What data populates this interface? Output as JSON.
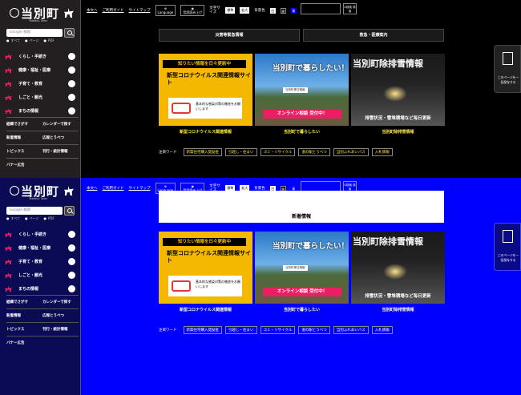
{
  "logo": {
    "title": "当別町",
    "subtitle": "Tobetsu Town"
  },
  "search": {
    "placeholder": "Google 検索",
    "options": [
      "すべて",
      "ページ",
      "PDF"
    ]
  },
  "menu": [
    {
      "label": "くらし・手続き"
    },
    {
      "label": "健康・福祉・医療"
    },
    {
      "label": "子育て・教育"
    },
    {
      "label": "しごと・観光"
    },
    {
      "label": "まちの情報"
    }
  ],
  "links": [
    [
      "組織でさがす",
      "カレンダーで探す"
    ],
    [
      "新着情報",
      "広報とうべつ"
    ],
    [
      "トピックス",
      "刊行・統計情報"
    ],
    [
      "バナー広告",
      ""
    ]
  ],
  "topbar": {
    "home": "本文へ",
    "guide": "ご利用ガイド",
    "sitemap": "サイトマップ",
    "language": "Language",
    "speech": "音読読み上げ",
    "textsize": "文字サイズ",
    "normal": "標準",
    "large": "拡大",
    "contrast": "背景色",
    "c1": "白",
    "c2": "黒",
    "c3": "青",
    "search_btn": "G検索 検索"
  },
  "nav": {
    "disaster": "災害等緊急情報",
    "medical": "救急・医療案内"
  },
  "banners": {
    "covid": {
      "top": "知りたい情報を日々更新中",
      "main": "新型コロナウイルス関連情報サイト",
      "card": "基本的な感染対策の徹底をお願いします",
      "caption": "新型コロナウイルス関連情報"
    },
    "living": {
      "title": "当別町で暮らしたい！",
      "chip": "当別町移住情報",
      "bar": "オンライン相談 受付中！",
      "caption": "当別町で暮らしたい"
    },
    "snow": {
      "title": "当別町除排雪情報",
      "sub": "排雪状況・雪堆積場など毎日更新",
      "caption": "当別町除排雪情報"
    }
  },
  "freeword": {
    "label": "注目ワード",
    "tags": [
      "新築住宅購入奨励金",
      "引越し・住まい",
      "ゴミ・リサイクル",
      "道の駅とうべつ",
      "当別ふれあいバス",
      "入札情報"
    ]
  },
  "side_tab": {
    "text": "このページを一括保存する"
  },
  "news": {
    "heading": "新着情報"
  },
  "colors": {
    "top_bg": "#000000",
    "bottom_bg": "#0000ff",
    "accent_yellow": "#f5b800",
    "accent_pink": "#e91e63"
  }
}
